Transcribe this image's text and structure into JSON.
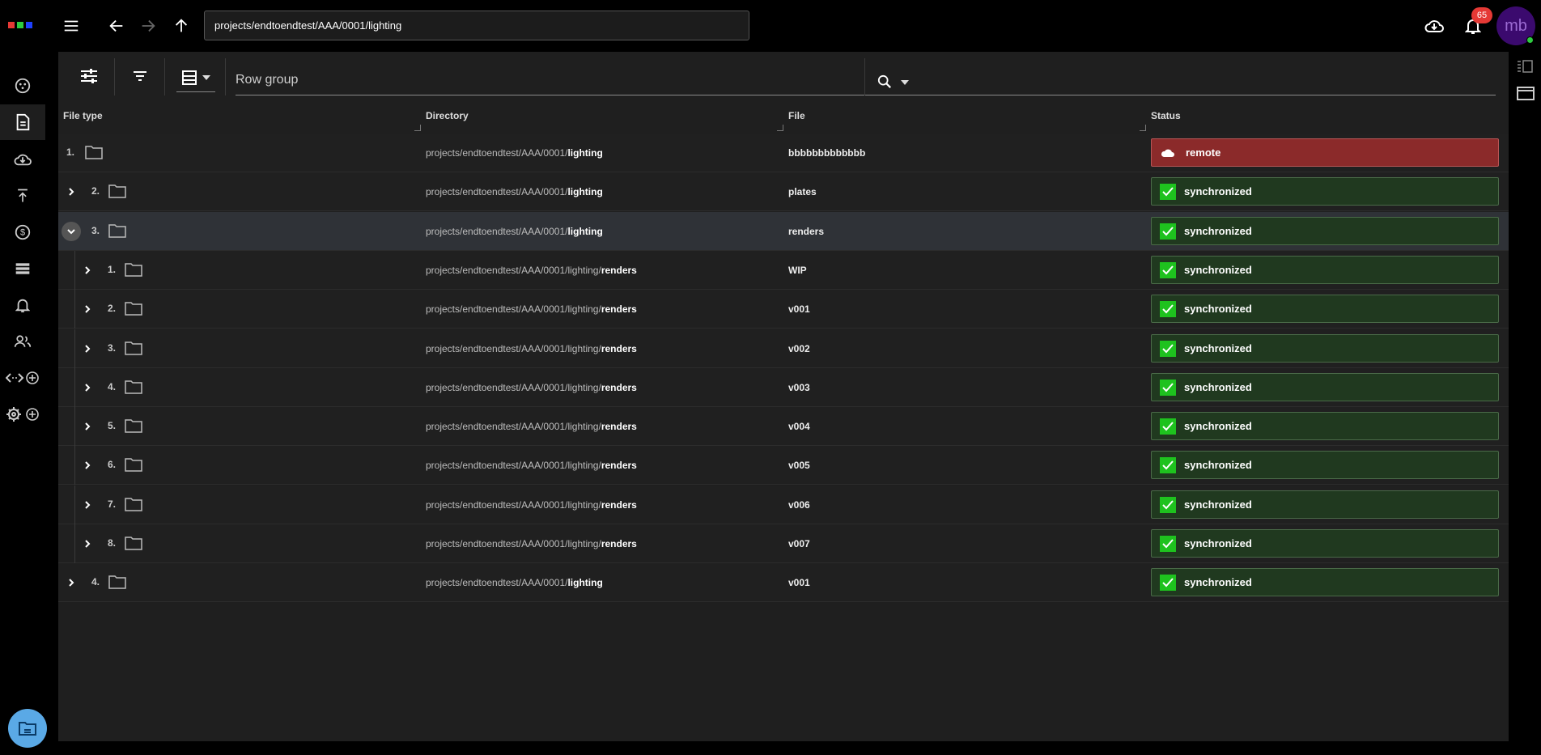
{
  "topbar": {
    "path_value": "projects/endtoendtest/AAA/0001/lighting",
    "notification_count": "65",
    "avatar_initials": "mb",
    "logo_colors": [
      "#e53935",
      "#2ecc40",
      "#1e40ff"
    ]
  },
  "sidebar": {
    "items": [
      {
        "icon": "dashboard-icon",
        "active": false
      },
      {
        "icon": "file-icon",
        "active": true
      },
      {
        "icon": "cloud-download-icon",
        "active": false
      },
      {
        "icon": "upload-icon",
        "active": false
      },
      {
        "icon": "dollar-icon",
        "active": false
      },
      {
        "icon": "server-list-icon",
        "active": false
      },
      {
        "icon": "bell-icon",
        "active": false
      },
      {
        "icon": "users-icon",
        "active": false
      },
      {
        "icon": "code-add-icon",
        "active": false
      },
      {
        "icon": "settings-add-icon",
        "active": false
      }
    ]
  },
  "toolbar": {
    "row_group_label": "Row group",
    "search_placeholder": ""
  },
  "table": {
    "columns": [
      "File type",
      "Directory",
      "File",
      "Status"
    ],
    "rows": [
      {
        "index": "1.",
        "level": 0,
        "expander": "none",
        "dir_prefix": "projects/endtoendtest/AAA/0001/",
        "dir_last": "lighting",
        "file": "bbbbbbbbbbbbb",
        "status": "remote"
      },
      {
        "index": "2.",
        "level": 0,
        "expander": "closed",
        "dir_prefix": "projects/endtoendtest/AAA/0001/",
        "dir_last": "lighting",
        "file": "plates",
        "status": "synchronized"
      },
      {
        "index": "3.",
        "level": 0,
        "expander": "open",
        "dir_prefix": "projects/endtoendtest/AAA/0001/",
        "dir_last": "lighting",
        "file": "renders",
        "status": "synchronized"
      },
      {
        "index": "1.",
        "level": 1,
        "expander": "closed",
        "dir_prefix": "projects/endtoendtest/AAA/0001/lighting/",
        "dir_last": "renders",
        "file": "WIP",
        "status": "synchronized"
      },
      {
        "index": "2.",
        "level": 1,
        "expander": "closed",
        "dir_prefix": "projects/endtoendtest/AAA/0001/lighting/",
        "dir_last": "renders",
        "file": "v001",
        "status": "synchronized"
      },
      {
        "index": "3.",
        "level": 1,
        "expander": "closed",
        "dir_prefix": "projects/endtoendtest/AAA/0001/lighting/",
        "dir_last": "renders",
        "file": "v002",
        "status": "synchronized"
      },
      {
        "index": "4.",
        "level": 1,
        "expander": "closed",
        "dir_prefix": "projects/endtoendtest/AAA/0001/lighting/",
        "dir_last": "renders",
        "file": "v003",
        "status": "synchronized"
      },
      {
        "index": "5.",
        "level": 1,
        "expander": "closed",
        "dir_prefix": "projects/endtoendtest/AAA/0001/lighting/",
        "dir_last": "renders",
        "file": "v004",
        "status": "synchronized"
      },
      {
        "index": "6.",
        "level": 1,
        "expander": "closed",
        "dir_prefix": "projects/endtoendtest/AAA/0001/lighting/",
        "dir_last": "renders",
        "file": "v005",
        "status": "synchronized"
      },
      {
        "index": "7.",
        "level": 1,
        "expander": "closed",
        "dir_prefix": "projects/endtoendtest/AAA/0001/lighting/",
        "dir_last": "renders",
        "file": "v006",
        "status": "synchronized"
      },
      {
        "index": "8.",
        "level": 1,
        "expander": "closed",
        "dir_prefix": "projects/endtoendtest/AAA/0001/lighting/",
        "dir_last": "renders",
        "file": "v007",
        "status": "synchronized"
      },
      {
        "index": "4.",
        "level": 0,
        "expander": "closed",
        "dir_prefix": "projects/endtoendtest/AAA/0001/",
        "dir_last": "lighting",
        "file": "v001",
        "status": "synchronized"
      }
    ]
  },
  "colors": {
    "synchronized": "#20391f",
    "remote": "#8b2a2a",
    "check": "#1ec21e"
  }
}
